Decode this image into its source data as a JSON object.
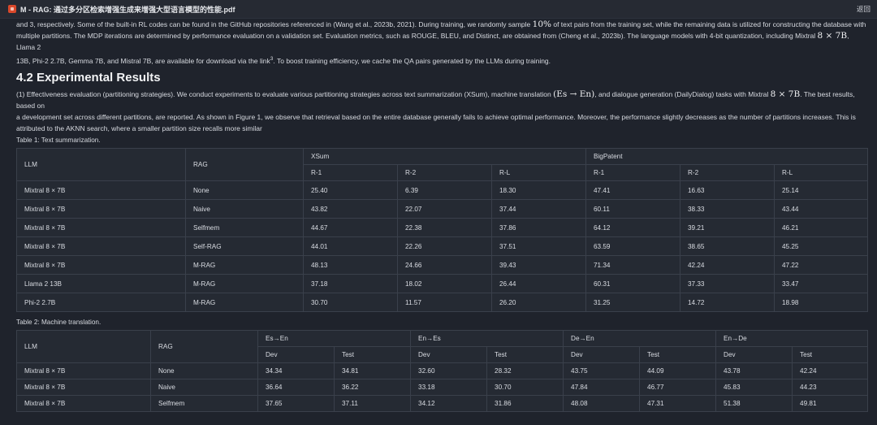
{
  "window": {
    "title": "M - RAG: 通过多分区检索增强生成来增强大型语言模型的性能.pdf",
    "back_label": "返回"
  },
  "intro": {
    "line1": "and 3, respectively. Some of the built-in RL codes can be found in the GitHub repositories referenced in (Wang et al., 2023b, 2021). During training, we randomly sample ",
    "line1_math": "10%",
    "line1b": " of text pairs from the training set, while the remaining data is utilized for constructing the database with",
    "line2": "multiple partitions. The MDP iterations are determined by performance evaluation on a validation set. Evaluation metrics, such as ROUGE, BLEU, and Distinct, are obtained from (Cheng et al., 2023b). The language models with 4-bit quantization, including Mixtral ",
    "line2_math": "8 × 7B",
    "line2b": ", Llama 2",
    "line3": "13B, Phi-2 2.7B, Gemma 7B, and Mistral 7B, are available for download via the link",
    "line3_sup": "3",
    "line3b": ". To boost training efficiency, we cache the QA pairs generated by the LLMs during training."
  },
  "section": {
    "heading": "4.2 Experimental Results"
  },
  "results": {
    "p1a": "(1) Effectiveness evaluation (partitioning strategies). We conduct experiments to evaluate various partitioning strategies across text summarization (XSum), machine translation ",
    "p1_math1": "(Es → En)",
    "p1b": ", and dialogue generation (DailyDialog) tasks with Mixtral ",
    "p1_math2": "8 × 7B",
    "p1c": ". The best results, based on",
    "p2": "a development set across different partitions, are reported. As shown in Figure 1, we observe that retrieval based on the entire database generally fails to achieve optimal performance. Moreover, the performance slightly decreases as the number of partitions increases. This is",
    "p3": "attributed to the AKNN search, where a smaller partition size recalls more similar"
  },
  "table1": {
    "caption": "Table 1: Text summarization.",
    "col_llm": "LLM",
    "col_rag": "RAG",
    "group1": "XSum",
    "group2": "BigPatent",
    "sub": [
      "R-1",
      "R-2",
      "R-L",
      "R-1",
      "R-2",
      "R-L"
    ],
    "rows": [
      [
        "Mixtral 8 × 7B",
        "None",
        "25.40",
        "6.39",
        "18.30",
        "47.41",
        "16.63",
        "25.14"
      ],
      [
        "Mixtral 8 × 7B",
        "Naive",
        "43.82",
        "22.07",
        "37.44",
        "60.11",
        "38.33",
        "43.44"
      ],
      [
        "Mixtral 8 × 7B",
        "Selfmem",
        "44.67",
        "22.38",
        "37.86",
        "64.12",
        "39.21",
        "46.21"
      ],
      [
        "Mixtral 8 × 7B",
        "Self-RAG",
        "44.01",
        "22.26",
        "37.51",
        "63.59",
        "38.65",
        "45.25"
      ],
      [
        "Mixtral 8 × 7B",
        "M-RAG",
        "48.13",
        "24.66",
        "39.43",
        "71.34",
        "42.24",
        "47.22"
      ],
      [
        "Llama 2 13B",
        "M-RAG",
        "37.18",
        "18.02",
        "26.44",
        "60.31",
        "37.33",
        "33.47"
      ],
      [
        "Phi-2 2.7B",
        "M-RAG",
        "30.70",
        "11.57",
        "26.20",
        "31.25",
        "14.72",
        "18.98"
      ]
    ]
  },
  "table2": {
    "caption": "Table 2: Machine translation.",
    "col_llm": "LLM",
    "col_rag": "RAG",
    "groups": [
      "Es→En",
      "En→Es",
      "De→En",
      "En→De"
    ],
    "sub": [
      "Dev",
      "Test",
      "Dev",
      "Test",
      "Dev",
      "Test",
      "Dev",
      "Test"
    ],
    "rows": [
      [
        "Mixtral 8 × 7B",
        "None",
        "34.34",
        "34.81",
        "32.60",
        "28.32",
        "43.75",
        "44.09",
        "43.78",
        "42.24"
      ],
      [
        "Mixtral 8 × 7B",
        "Naive",
        "36.64",
        "36.22",
        "33.18",
        "30.70",
        "47.84",
        "46.77",
        "45.83",
        "44.23"
      ],
      [
        "Mixtral 8 × 7B",
        "Selfmem",
        "37.65",
        "37.11",
        "34.12",
        "31.86",
        "48.08",
        "47.31",
        "51.38",
        "49.81"
      ]
    ]
  }
}
